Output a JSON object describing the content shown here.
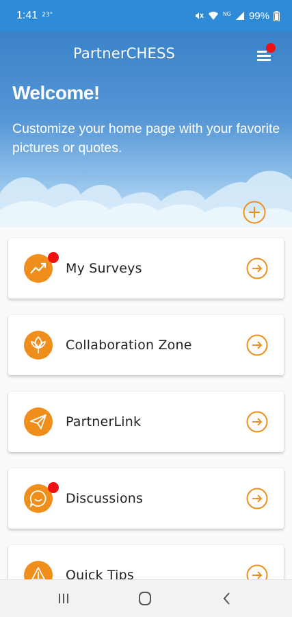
{
  "status_bar": {
    "time": "1:41",
    "temperature": "23°",
    "network": "NG",
    "battery": "99%"
  },
  "header": {
    "app_title": "PartnerCHESS",
    "menu_icon": "hamburger-menu-icon",
    "notification_color": "#ee1111"
  },
  "hero": {
    "welcome": "Welcome!",
    "subtitle": "Customize your home page with your favorite pictures or quotes.",
    "add_icon": "plus-circle-icon"
  },
  "colors": {
    "accent": "#f08e1b",
    "header_blue": "#2f8ad8",
    "badge": "#ee1111"
  },
  "cards": [
    {
      "label": "My Surveys",
      "icon": "trending-up-icon",
      "has_badge": true
    },
    {
      "label": "Collaboration Zone",
      "icon": "leaf-icon",
      "has_badge": false
    },
    {
      "label": "PartnerLink",
      "icon": "paper-plane-icon",
      "has_badge": false
    },
    {
      "label": "Discussions",
      "icon": "chat-smile-icon",
      "has_badge": true
    },
    {
      "label": "Quick Tips",
      "icon": "lightbulb-icon",
      "has_badge": false
    }
  ],
  "nav_bar": {
    "buttons": [
      "recent-apps-icon",
      "home-icon",
      "back-icon"
    ]
  }
}
